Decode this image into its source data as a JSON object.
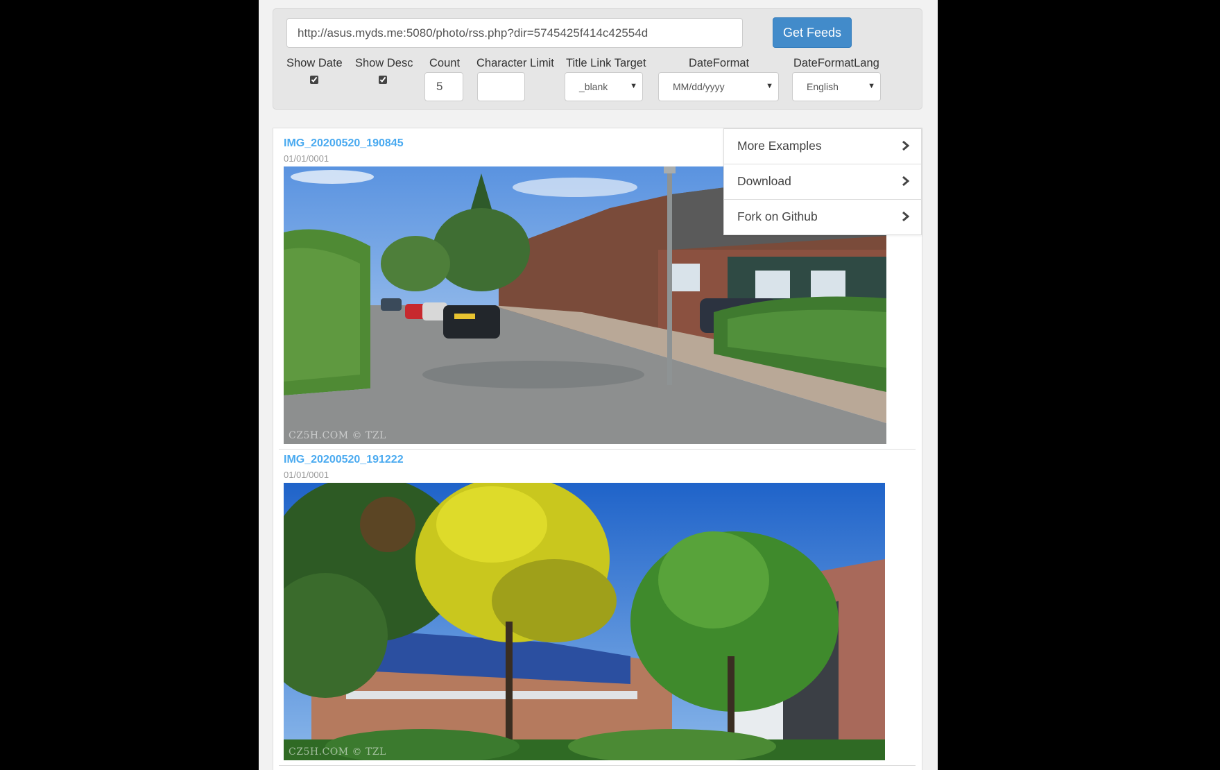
{
  "controls": {
    "feed_url": "http://asus.myds.me:5080/photo/rss.php?dir=5745425f414c42554d",
    "get_feeds_label": "Get Feeds",
    "show_date": {
      "label": "Show Date",
      "checked": true
    },
    "show_desc": {
      "label": "Show Desc",
      "checked": true
    },
    "count": {
      "label": "Count",
      "value": "5"
    },
    "character_limit": {
      "label": "Character Limit",
      "value": ""
    },
    "title_link_target": {
      "label": "Title Link Target",
      "value": "_blank"
    },
    "date_format": {
      "label": "DateFormat",
      "value": "MM/dd/yyyy"
    },
    "date_format_lang": {
      "label": "DateFormatLang",
      "value": "English"
    }
  },
  "feed": {
    "items": [
      {
        "title": "IMG_20200520_190845",
        "date": "01/01/0001",
        "watermark": "CZ5H.COM © TZL"
      },
      {
        "title": "IMG_20200520_191222",
        "date": "01/01/0001",
        "watermark": "CZ5H.COM © TZL"
      }
    ]
  },
  "side_menu": {
    "items": [
      {
        "label": "More Examples",
        "icon": "chevron-right-icon"
      },
      {
        "label": "Download",
        "icon": "chevron-right-icon"
      },
      {
        "label": "Fork on Github",
        "icon": "chevron-right-icon"
      }
    ]
  },
  "colors": {
    "link": "#4aaaf0",
    "button": "#428bca",
    "backdrop": "#000000"
  }
}
